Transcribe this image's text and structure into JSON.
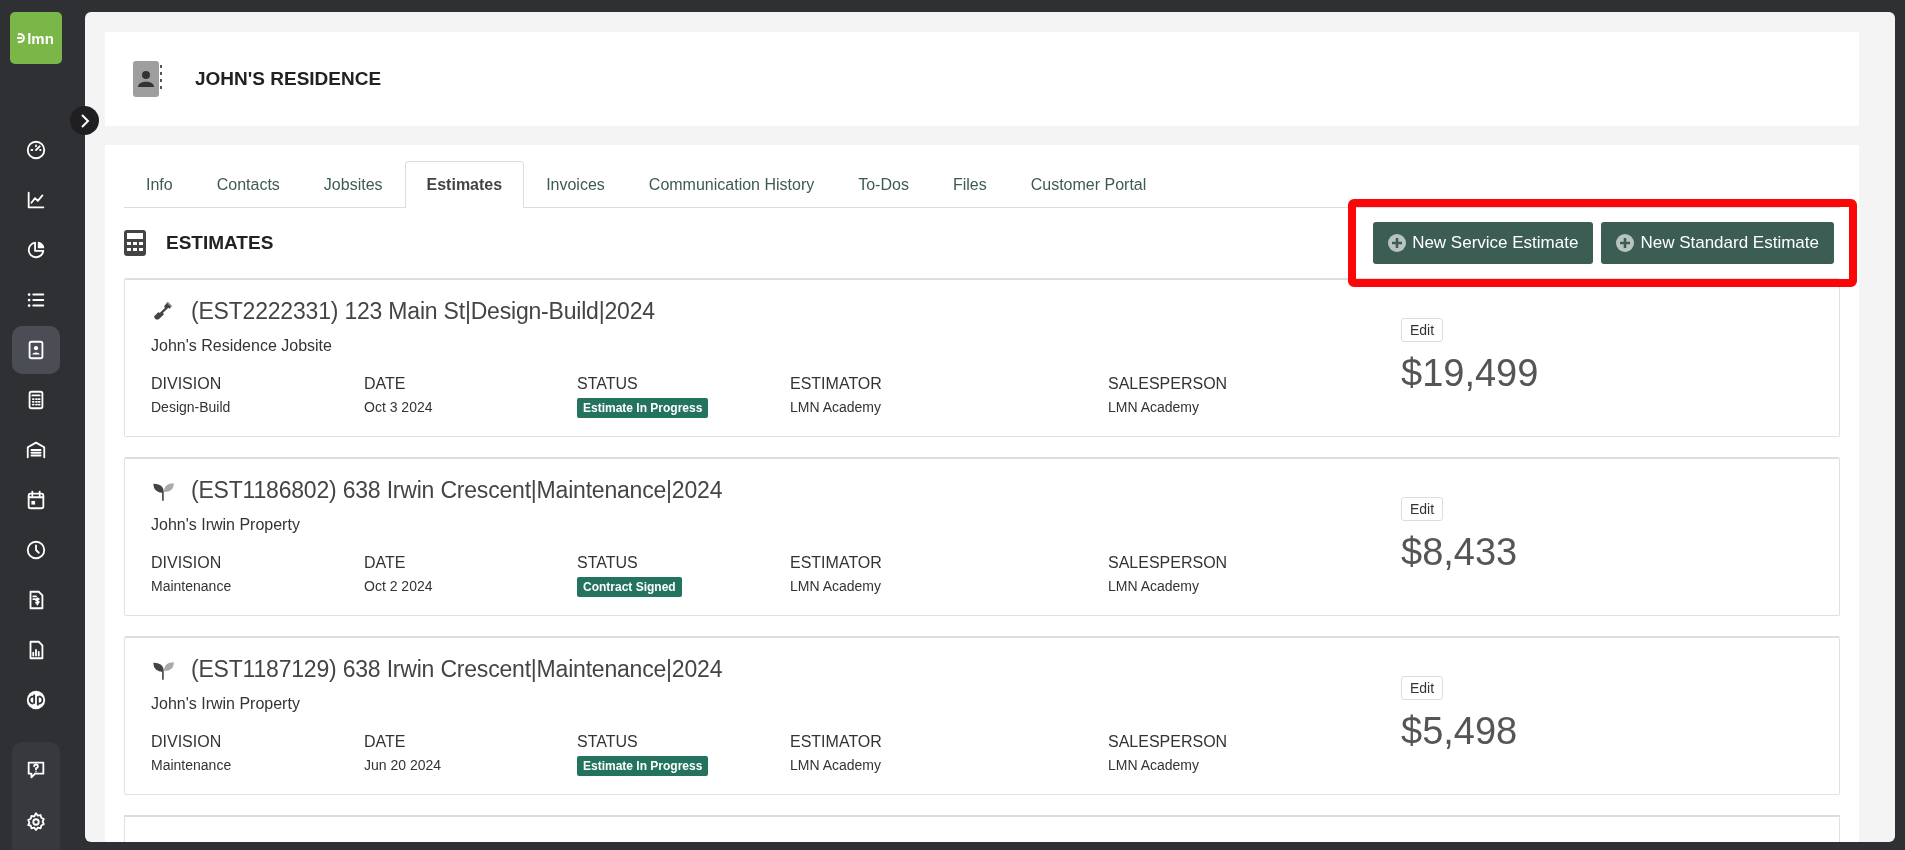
{
  "sidebar": {
    "logo": "lmn",
    "items": [
      {
        "kind": "gauge",
        "selected": false
      },
      {
        "kind": "line-chart",
        "selected": false
      },
      {
        "kind": "pie-chart",
        "selected": false
      },
      {
        "kind": "list",
        "selected": false
      },
      {
        "kind": "contact",
        "selected": true
      },
      {
        "kind": "calculator",
        "selected": false
      },
      {
        "kind": "garage",
        "selected": false
      },
      {
        "kind": "calendar",
        "selected": false
      },
      {
        "kind": "clock",
        "selected": false
      },
      {
        "kind": "invoice",
        "selected": false
      },
      {
        "kind": "report",
        "selected": false
      },
      {
        "kind": "qb",
        "selected": false
      }
    ],
    "bottom_items": [
      {
        "kind": "help",
        "selected": false
      },
      {
        "kind": "settings",
        "selected": false
      }
    ]
  },
  "header": {
    "title": "JOHN'S RESIDENCE"
  },
  "tabs": [
    {
      "label": "Info",
      "selected": false
    },
    {
      "label": "Contacts",
      "selected": false
    },
    {
      "label": "Jobsites",
      "selected": false
    },
    {
      "label": "Estimates",
      "selected": true
    },
    {
      "label": "Invoices",
      "selected": false
    },
    {
      "label": "Communication History",
      "selected": false
    },
    {
      "label": "To-Dos",
      "selected": false
    },
    {
      "label": "Files",
      "selected": false
    },
    {
      "label": "Customer Portal",
      "selected": false
    }
  ],
  "section": {
    "title": "ESTIMATES",
    "buttons": [
      "New Service Estimate",
      "New Standard Estimate"
    ],
    "highlighted": true
  },
  "estimates": [
    {
      "kind": "shovel",
      "title": "(EST2222331) 123 Main St|Design-Build|2024",
      "jobsite": "John's Residence Jobsite",
      "edit": "Edit",
      "total": "$19,499",
      "fields": [
        {
          "kind": "text",
          "label": "DIVISION",
          "value": "Design-Build"
        },
        {
          "kind": "text",
          "label": "DATE",
          "value": "Oct 3 2024"
        },
        {
          "kind": "badge",
          "label": "STATUS",
          "value": "Estimate In Progress"
        },
        {
          "kind": "text",
          "label": "ESTIMATOR",
          "value": "LMN Academy"
        },
        {
          "kind": "text",
          "label": "SALESPERSON",
          "value": "LMN Academy"
        }
      ]
    },
    {
      "kind": "sprout",
      "title": "(EST1186802) 638 Irwin Crescent|Maintenance|2024",
      "jobsite": "John's Irwin Property",
      "edit": "Edit",
      "total": "$8,433",
      "fields": [
        {
          "kind": "text",
          "label": "DIVISION",
          "value": "Maintenance"
        },
        {
          "kind": "text",
          "label": "DATE",
          "value": "Oct 2 2024"
        },
        {
          "kind": "badge",
          "label": "STATUS",
          "value": "Contract Signed"
        },
        {
          "kind": "text",
          "label": "ESTIMATOR",
          "value": "LMN Academy"
        },
        {
          "kind": "text",
          "label": "SALESPERSON",
          "value": "LMN Academy"
        }
      ]
    },
    {
      "kind": "sprout",
      "title": "(EST1187129) 638 Irwin Crescent|Maintenance|2024",
      "jobsite": "John's Irwin Property",
      "edit": "Edit",
      "total": "$5,498",
      "fields": [
        {
          "kind": "text",
          "label": "DIVISION",
          "value": "Maintenance"
        },
        {
          "kind": "text",
          "label": "DATE",
          "value": "Jun 20 2024"
        },
        {
          "kind": "badge",
          "label": "STATUS",
          "value": "Estimate In Progress"
        },
        {
          "kind": "text",
          "label": "ESTIMATOR",
          "value": "LMN Academy"
        },
        {
          "kind": "text",
          "label": "SALESPERSON",
          "value": "LMN Academy"
        }
      ]
    }
  ]
}
